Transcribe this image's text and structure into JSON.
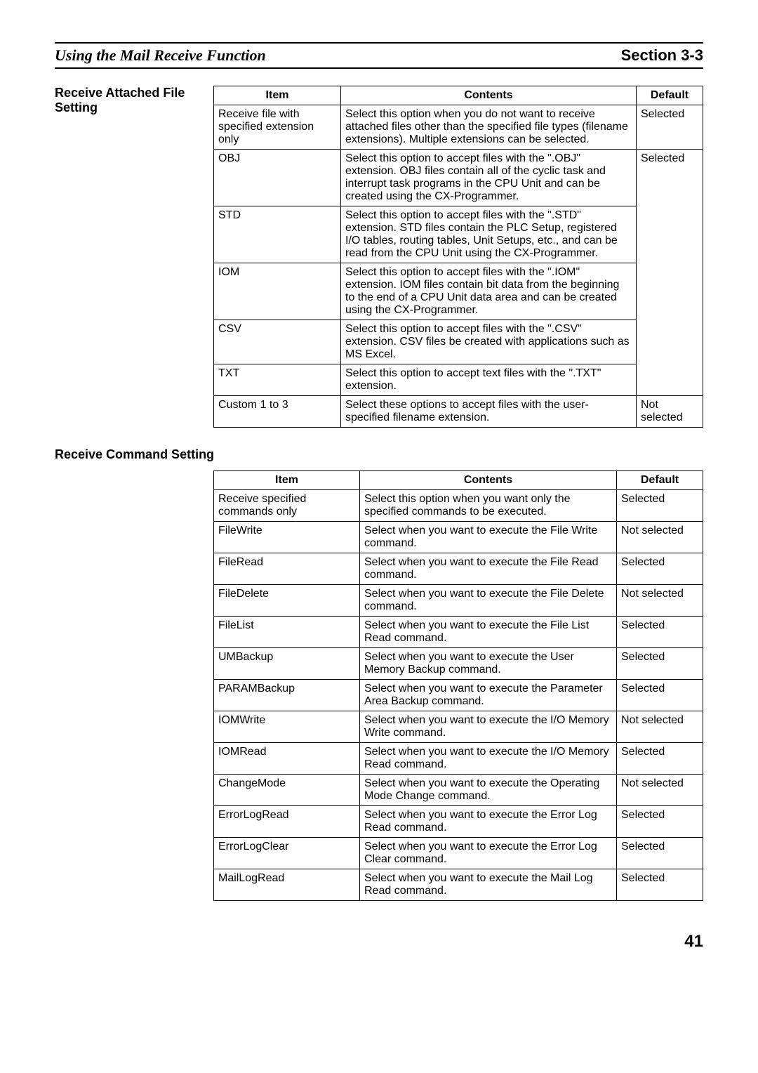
{
  "header": {
    "left": "Using the Mail Receive Function",
    "right": "Section 3-3"
  },
  "sections": [
    {
      "title": "Receive Attached File Setting",
      "headers": [
        "Item",
        "Contents",
        "Default"
      ],
      "rows": [
        {
          "item": "Receive file with specified extension only",
          "contents": "Select this option when you do not want to receive attached files other than the specified file types (filename extensions). Multiple extensions can be selected.",
          "default": "Selected"
        },
        {
          "item": "OBJ",
          "contents": "Select this option to accept files with the \".OBJ\" extension. OBJ files contain all of the cyclic task and interrupt task programs in the CPU Unit and can be created using the CX-Programmer.",
          "default": "Selected"
        },
        {
          "item": "STD",
          "contents": "Select this option to accept files with the \".STD\" extension. STD files contain the PLC Setup, registered I/O tables, routing tables, Unit Setups, etc., and can be read from the CPU Unit using the CX-Programmer.",
          "default": ""
        },
        {
          "item": "IOM",
          "contents": "Select this option to accept files with the \".IOM\" extension. IOM files contain bit data from the beginning to the end of a CPU Unit data area and can be created using the CX-Programmer.",
          "default": ""
        },
        {
          "item": "CSV",
          "contents": "Select this option to accept files with the \".CSV\" extension. CSV files be created with applications such as MS Excel.",
          "default": ""
        },
        {
          "item": "TXT",
          "contents": "Select this option to accept text files with the \".TXT\" extension.",
          "default": ""
        },
        {
          "item": "Custom 1 to 3",
          "contents": "Select these options to accept files with the user-specified filename extension.",
          "default": "Not selected"
        }
      ]
    },
    {
      "title": "Receive Command Setting",
      "headers": [
        "Item",
        "Contents",
        "Default"
      ],
      "rows": [
        {
          "item": "Receive specified commands only",
          "contents": "Select this option when you want only the specified commands to be executed.",
          "default": "Selected"
        },
        {
          "item": "FileWrite",
          "contents": "Select when you want to execute the File Write command.",
          "default": "Not selected"
        },
        {
          "item": "FileRead",
          "contents": "Select when you want to execute the File Read command.",
          "default": "Selected"
        },
        {
          "item": "FileDelete",
          "contents": "Select when you want to execute the File Delete command.",
          "default": "Not selected"
        },
        {
          "item": "FileList",
          "contents": "Select when you want to execute the File List Read command.",
          "default": "Selected"
        },
        {
          "item": "UMBackup",
          "contents": "Select when you want to execute the User Memory Backup command.",
          "default": "Selected"
        },
        {
          "item": "PARAMBackup",
          "contents": "Select when you want to execute the Parameter Area Backup command.",
          "default": "Selected"
        },
        {
          "item": "IOMWrite",
          "contents": "Select when you want to execute the I/O Memory Write command.",
          "default": "Not selected"
        },
        {
          "item": "IOMRead",
          "contents": "Select when you want to execute the I/O Memory Read command.",
          "default": "Selected"
        },
        {
          "item": "ChangeMode",
          "contents": "Select when you want to execute the Operating Mode Change command.",
          "default": "Not selected"
        },
        {
          "item": "ErrorLogRead",
          "contents": "Select when you want to execute the Error Log Read command.",
          "default": "Selected"
        },
        {
          "item": "ErrorLogClear",
          "contents": "Select when you want to execute the Error Log Clear command.",
          "default": "Selected"
        },
        {
          "item": "MailLogRead",
          "contents": "Select when you want to execute the Mail Log Read command.",
          "default": "Selected"
        }
      ]
    }
  ],
  "page_number": "41"
}
